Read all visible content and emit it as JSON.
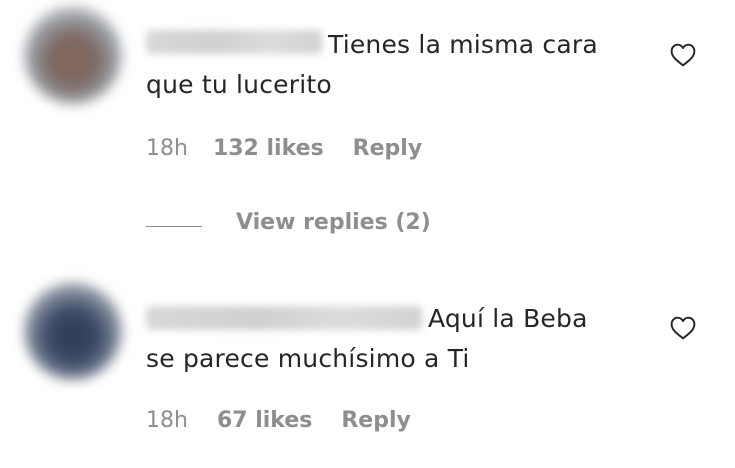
{
  "comments": [
    {
      "text_line1": "Tienes la misma cara",
      "text_line2": "que tu lucerito",
      "time": "18h",
      "likes": "132 likes",
      "reply": "Reply"
    },
    {
      "text_line1": "Aquí la Beba",
      "text_line2": "se parece muchísimo a Ti",
      "time": "18h",
      "likes": "67 likes",
      "reply": "Reply"
    }
  ],
  "view_replies": "View replies (2)",
  "colors": {
    "text": "#262626",
    "meta": "#8e8e8e"
  }
}
